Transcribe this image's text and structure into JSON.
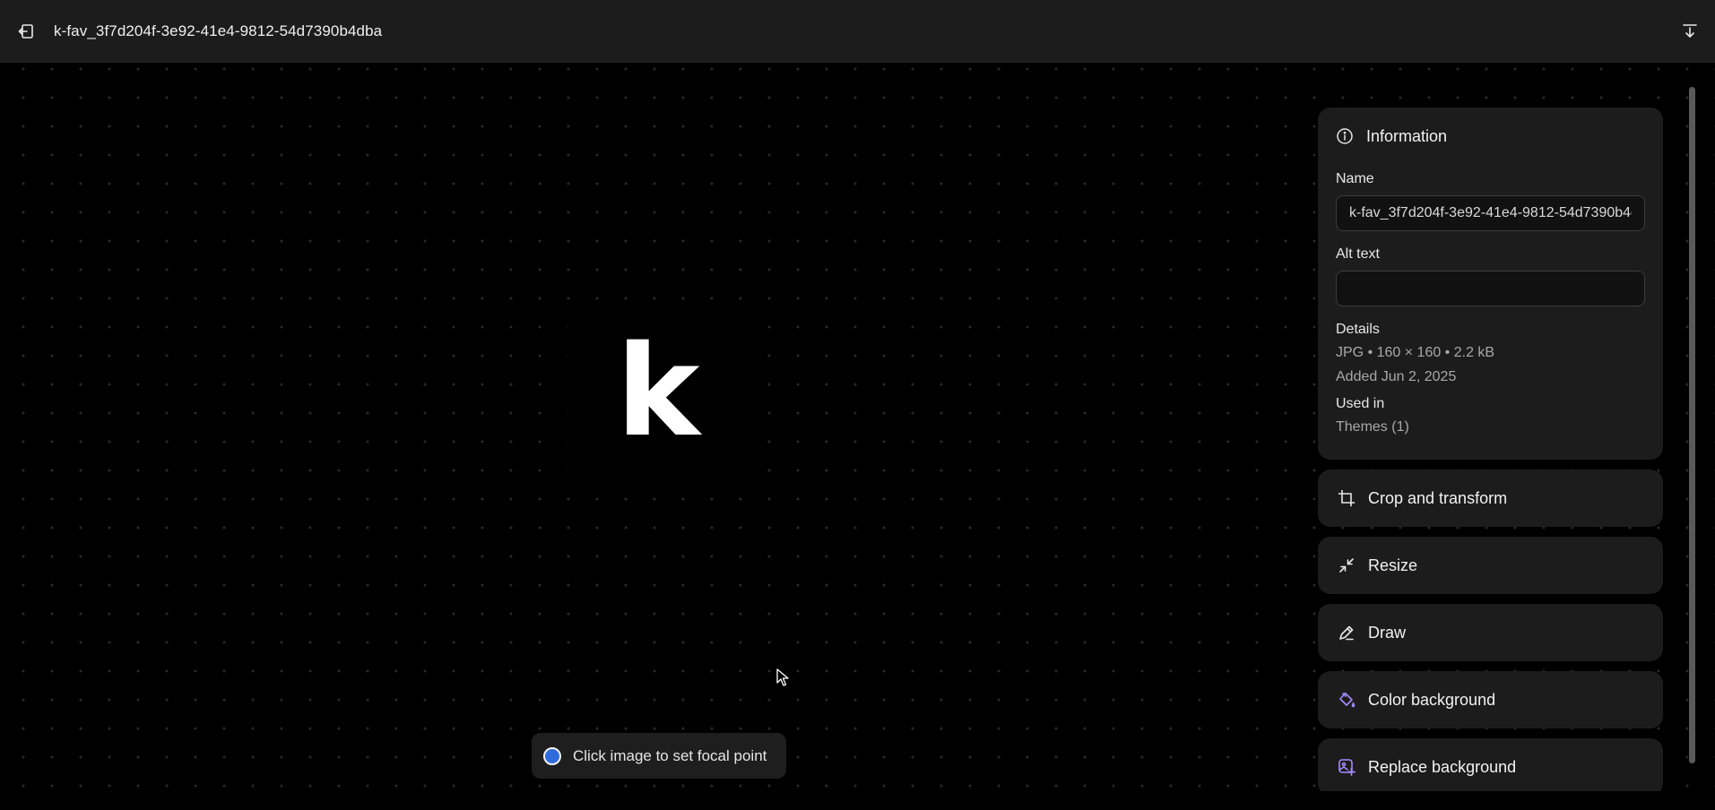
{
  "header": {
    "title": "k-fav_3f7d204f-3e92-41e4-9812-54d7390b4dba",
    "back_icon": "exit-icon",
    "download_icon": "download-icon"
  },
  "preview": {
    "letter": "k"
  },
  "focal_hint": {
    "text": "Click image to set focal point",
    "dot_color": "#2f6bdc"
  },
  "info": {
    "heading": "Information",
    "name_label": "Name",
    "name_value": "k-fav_3f7d204f-3e92-41e4-9812-54d7390b4dba",
    "alt_label": "Alt text",
    "alt_value": "",
    "details_label": "Details",
    "details_line1": "JPG • 160 × 160 • 2.2 kB",
    "details_line2": "Added Jun 2, 2025",
    "used_in_label": "Used in",
    "used_in_value": "Themes (1)"
  },
  "actions": [
    {
      "label": "Crop and transform",
      "icon": "crop-icon"
    },
    {
      "label": "Resize",
      "icon": "resize-icon"
    },
    {
      "label": "Draw",
      "icon": "draw-icon"
    },
    {
      "label": "Color background",
      "icon": "color-background-icon",
      "accent": "#a38bff"
    },
    {
      "label": "Replace background",
      "icon": "replace-background-icon",
      "accent": "#a38bff"
    }
  ]
}
